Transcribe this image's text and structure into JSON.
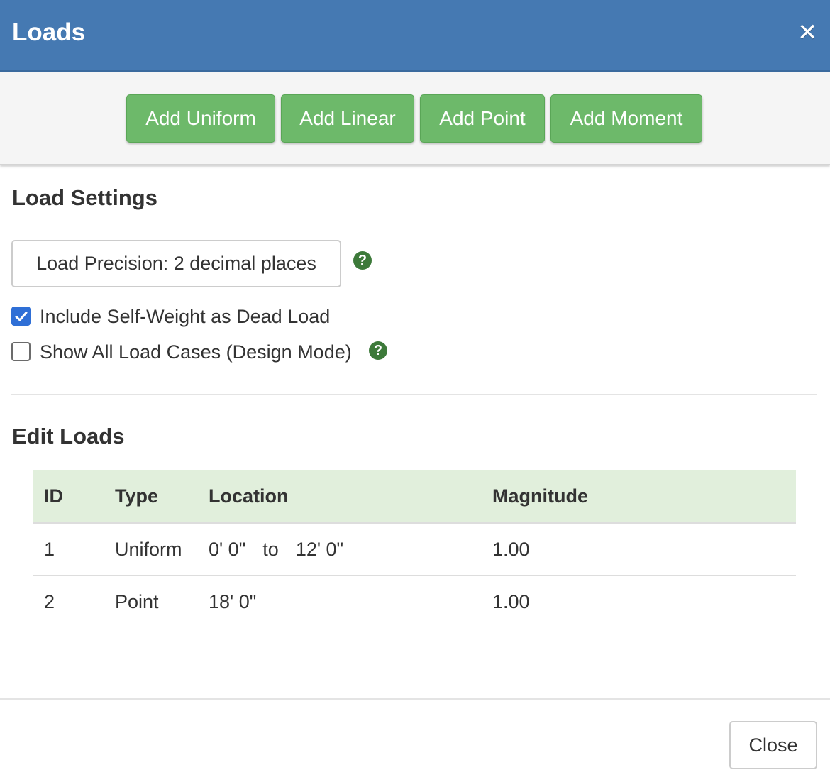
{
  "header": {
    "title": "Loads",
    "close_glyph": "✕"
  },
  "toolbar": {
    "add_uniform": "Add Uniform",
    "add_linear": "Add Linear",
    "add_point": "Add Point",
    "add_moment": "Add Moment"
  },
  "settings": {
    "title": "Load Settings",
    "precision_label": "Load Precision: 2 decimal places",
    "self_weight_label": "Include Self-Weight as Dead Load",
    "self_weight_checked": true,
    "show_all_label": "Show All Load Cases (Design Mode)",
    "show_all_checked": false,
    "help_glyph": "?"
  },
  "edit_loads": {
    "title": "Edit Loads",
    "columns": [
      "ID",
      "Type",
      "Location",
      "Magnitude"
    ],
    "rows": [
      {
        "id": "1",
        "type": "Uniform",
        "loc_start": "0' 0\"",
        "loc_to": "to",
        "loc_end": "12' 0\"",
        "magnitude": "1.00"
      },
      {
        "id": "2",
        "type": "Point",
        "loc_start": "18' 0\"",
        "loc_to": "",
        "loc_end": "",
        "magnitude": "1.00"
      }
    ]
  },
  "footer": {
    "close_label": "Close"
  },
  "colors": {
    "header_bg": "#4579b2",
    "button_green": "#6db96a",
    "table_header_bg": "#e1efdc",
    "help_icon": "#3d7a3a",
    "checkbox_checked": "#2f6fd6"
  }
}
